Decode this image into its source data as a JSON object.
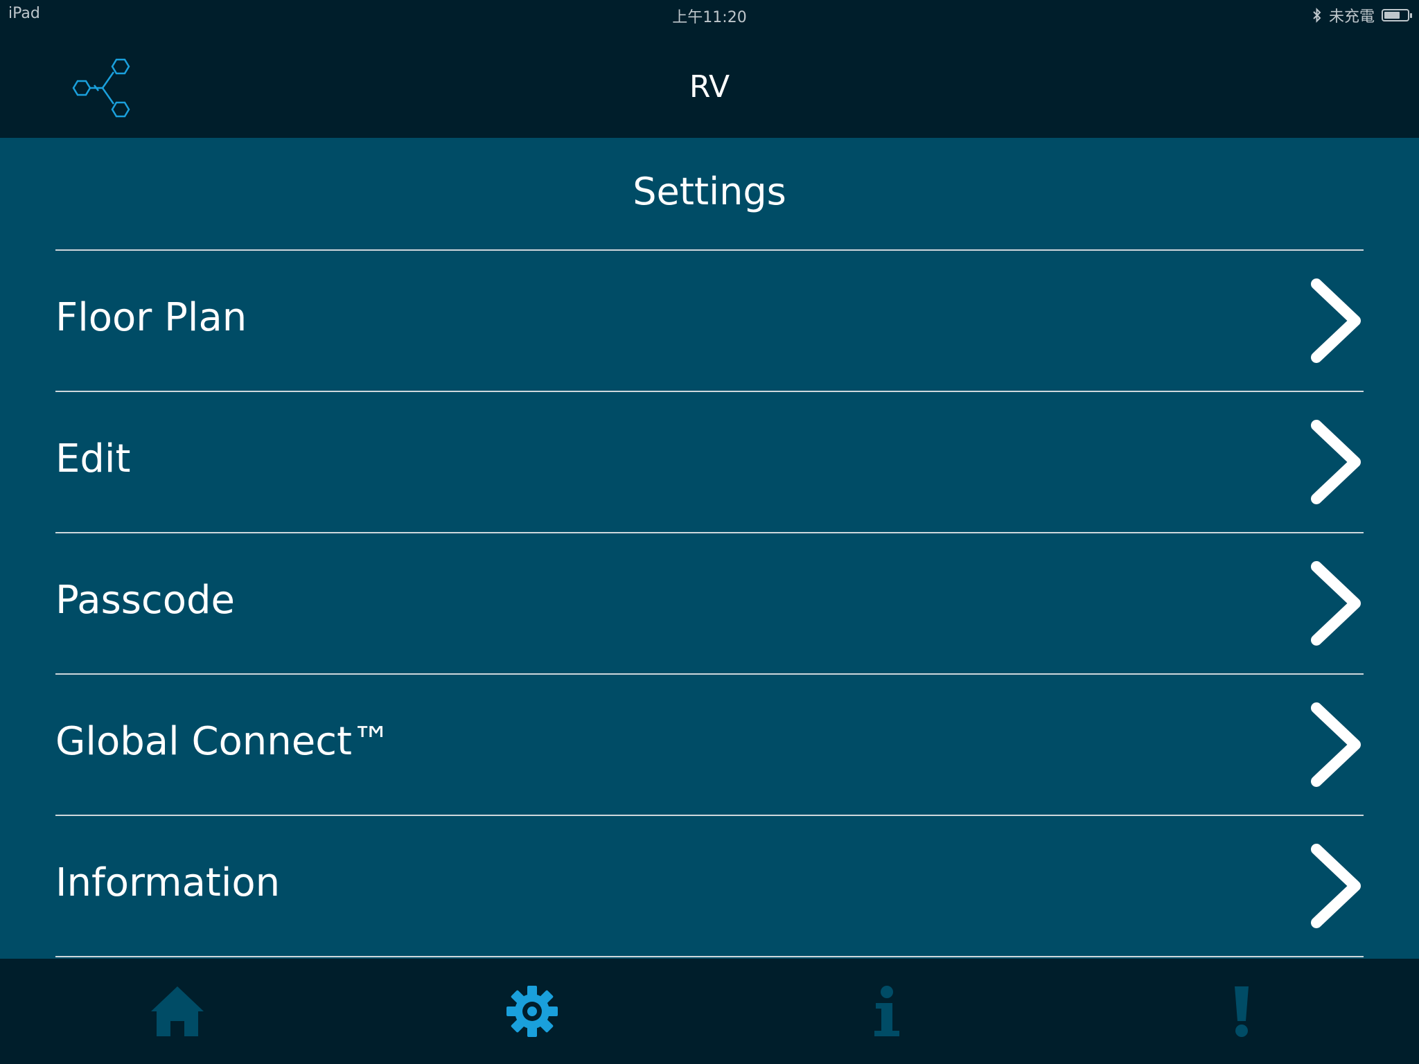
{
  "status_bar": {
    "device": "iPad",
    "time": "上午11:20",
    "bluetooth_icon": "bluetooth-icon",
    "charging_status": "未充電",
    "battery_level": 0.7
  },
  "nav": {
    "title": "RV",
    "logo_icon": "network-hexagon-logo"
  },
  "settings": {
    "title": "Settings",
    "items": [
      {
        "label": "Floor Plan",
        "icon": "chevron-right-icon"
      },
      {
        "label": "Edit",
        "icon": "chevron-right-icon"
      },
      {
        "label": "Passcode",
        "icon": "chevron-right-icon"
      },
      {
        "label": "Global Connect™",
        "icon": "chevron-right-icon"
      },
      {
        "label": "Information",
        "icon": "chevron-right-icon"
      }
    ]
  },
  "tab_bar": {
    "tabs": [
      {
        "icon": "home-icon",
        "active": false
      },
      {
        "icon": "gear-icon",
        "active": true
      },
      {
        "icon": "info-icon",
        "active": false
      },
      {
        "icon": "alert-icon",
        "active": false
      }
    ]
  },
  "colors": {
    "header_bg": "#001e2b",
    "content_bg": "#004c66",
    "divider": "#cfd8dc",
    "tab_active": "#1aa0dc",
    "tab_inactive": "#004c66",
    "logo": "#1aa0dc"
  }
}
